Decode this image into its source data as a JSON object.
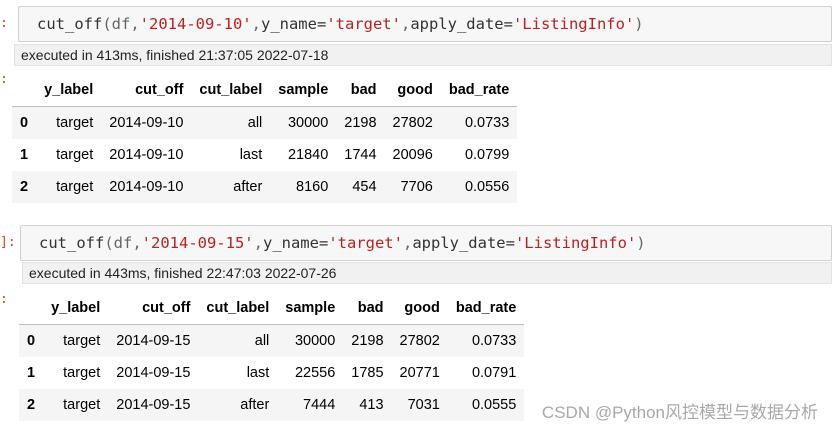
{
  "cells": [
    {
      "prompt": ":",
      "output_prompt": ":",
      "code": {
        "fn": "cut_off",
        "open": "(df,",
        "date": "'2014-09-10'",
        "comma1": ",",
        "kw1": "y_name=",
        "yname": "'target'",
        "comma2": ",",
        "kw2": "apply_date=",
        "applydate": "'ListingInfo'",
        "close": ")"
      },
      "exec": "executed in 413ms, finished 21:37:05 2022-07-18",
      "table": {
        "columns": [
          "",
          "y_label",
          "cut_off",
          "cut_label",
          "sample",
          "bad",
          "good",
          "bad_rate"
        ],
        "rows": [
          [
            "0",
            "target",
            "2014-09-10",
            "all",
            "30000",
            "2198",
            "27802",
            "0.0733"
          ],
          [
            "1",
            "target",
            "2014-09-10",
            "last",
            "21840",
            "1744",
            "20096",
            "0.0799"
          ],
          [
            "2",
            "target",
            "2014-09-10",
            "after",
            "8160",
            "454",
            "7706",
            "0.0556"
          ]
        ]
      }
    },
    {
      "prompt": "]:",
      "output_prompt": ":",
      "code": {
        "fn": "cut_off",
        "open": "(df,",
        "date": "'2014-09-15'",
        "comma1": ",",
        "kw1": "y_name=",
        "yname": "'target'",
        "comma2": ",",
        "kw2": "apply_date=",
        "applydate": "'ListingInfo'",
        "close": ")"
      },
      "exec": "executed in 443ms, finished 22:47:03 2022-07-26",
      "table": {
        "columns": [
          "",
          "y_label",
          "cut_off",
          "cut_label",
          "sample",
          "bad",
          "good",
          "bad_rate"
        ],
        "rows": [
          [
            "0",
            "target",
            "2014-09-15",
            "all",
            "30000",
            "2198",
            "27802",
            "0.0733"
          ],
          [
            "1",
            "target",
            "2014-09-15",
            "last",
            "22556",
            "1785",
            "20771",
            "0.0791"
          ],
          [
            "2",
            "target",
            "2014-09-15",
            "after",
            "7444",
            "413",
            "7031",
            "0.0555"
          ]
        ]
      }
    }
  ],
  "watermark": "CSDN @Python风控模型与数据分析"
}
